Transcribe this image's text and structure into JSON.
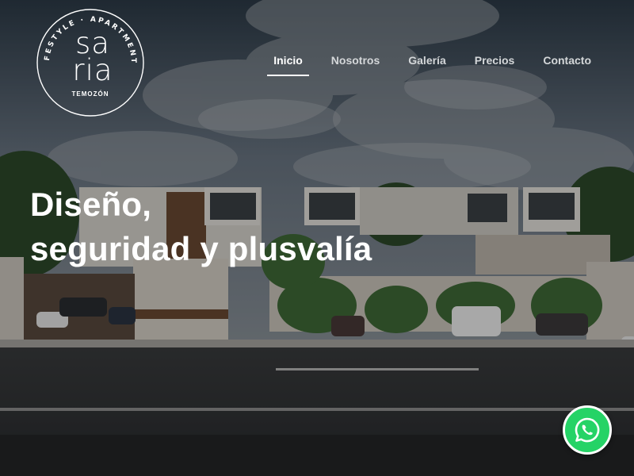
{
  "brand": {
    "arc_text": "LIFESTYLE · APARTMENTS",
    "name_line1": "sa",
    "name_line2": "ria",
    "city": "TEMOZÓN"
  },
  "nav": {
    "items": [
      {
        "label": "Inicio",
        "active": true
      },
      {
        "label": "Nosotros",
        "active": false
      },
      {
        "label": "Galería",
        "active": false
      },
      {
        "label": "Precios",
        "active": false
      },
      {
        "label": "Contacto",
        "active": false
      }
    ]
  },
  "hero": {
    "headline_line1": "Diseño,",
    "headline_line2": "seguridad y plusvalía"
  },
  "colors": {
    "text": "#ffffff",
    "nav_inactive": "#d4d7d9",
    "whatsapp_green": "#25d366"
  },
  "widgets": {
    "whatsapp_icon": "whatsapp-icon"
  }
}
